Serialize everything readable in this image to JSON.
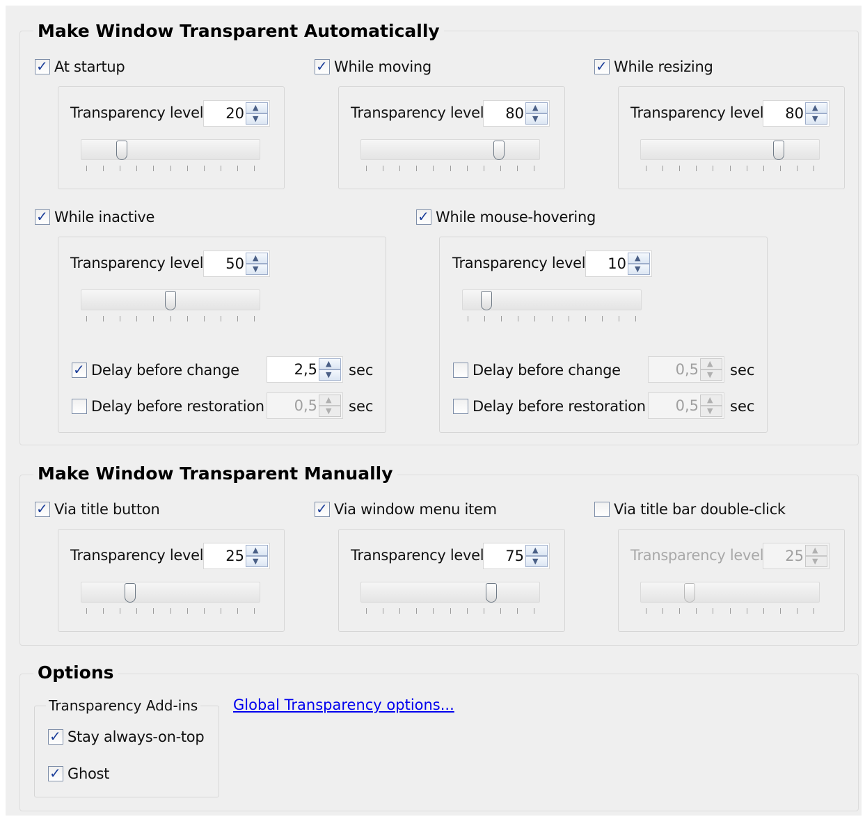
{
  "auto": {
    "title": "Make Window Transparent Automatically",
    "at_startup": {
      "label": "At startup",
      "checked": true,
      "level_label": "Transparency level",
      "level": "20",
      "slider_fraction": 0.2
    },
    "while_moving": {
      "label": "While moving",
      "checked": true,
      "level_label": "Transparency level",
      "level": "80",
      "slider_fraction": 0.8
    },
    "while_resizing": {
      "label": "While resizing",
      "checked": true,
      "level_label": "Transparency level",
      "level": "80",
      "slider_fraction": 0.8
    },
    "while_inactive": {
      "label": "While inactive",
      "checked": true,
      "level_label": "Transparency level",
      "level": "50",
      "slider_fraction": 0.5,
      "delay_change": {
        "label": "Delay before change",
        "checked": true,
        "value": "2,5",
        "unit": "sec"
      },
      "delay_restore": {
        "label": "Delay before restoration",
        "checked": false,
        "value": "0,5",
        "unit": "sec"
      }
    },
    "while_hovering": {
      "label": "While mouse-hovering",
      "checked": true,
      "level_label": "Transparency level",
      "level": "10",
      "slider_fraction": 0.1,
      "delay_change": {
        "label": "Delay before change",
        "checked": false,
        "value": "0,5",
        "unit": "sec"
      },
      "delay_restore": {
        "label": "Delay before restoration",
        "checked": false,
        "value": "0,5",
        "unit": "sec"
      }
    }
  },
  "manual": {
    "title": "Make Window Transparent Manually",
    "via_title_button": {
      "label": "Via title button",
      "checked": true,
      "level_label": "Transparency level",
      "level": "25",
      "slider_fraction": 0.25
    },
    "via_window_menu": {
      "label": "Via window menu item",
      "checked": true,
      "level_label": "Transparency level",
      "level": "75",
      "slider_fraction": 0.75
    },
    "via_double_click": {
      "label": "Via title bar double-click",
      "checked": false,
      "level_label": "Transparency level",
      "level": "25",
      "slider_fraction": 0.25
    }
  },
  "options": {
    "title": "Options",
    "addins_title": "Transparency Add-ins",
    "stay_on_top": {
      "label": "Stay always-on-top",
      "checked": true
    },
    "ghost": {
      "label": "Ghost",
      "checked": true
    },
    "global_link": "Global Transparency options..."
  },
  "icons": {
    "check": "checkmark-icon",
    "up": "spin-up-icon",
    "down": "spin-down-icon"
  }
}
